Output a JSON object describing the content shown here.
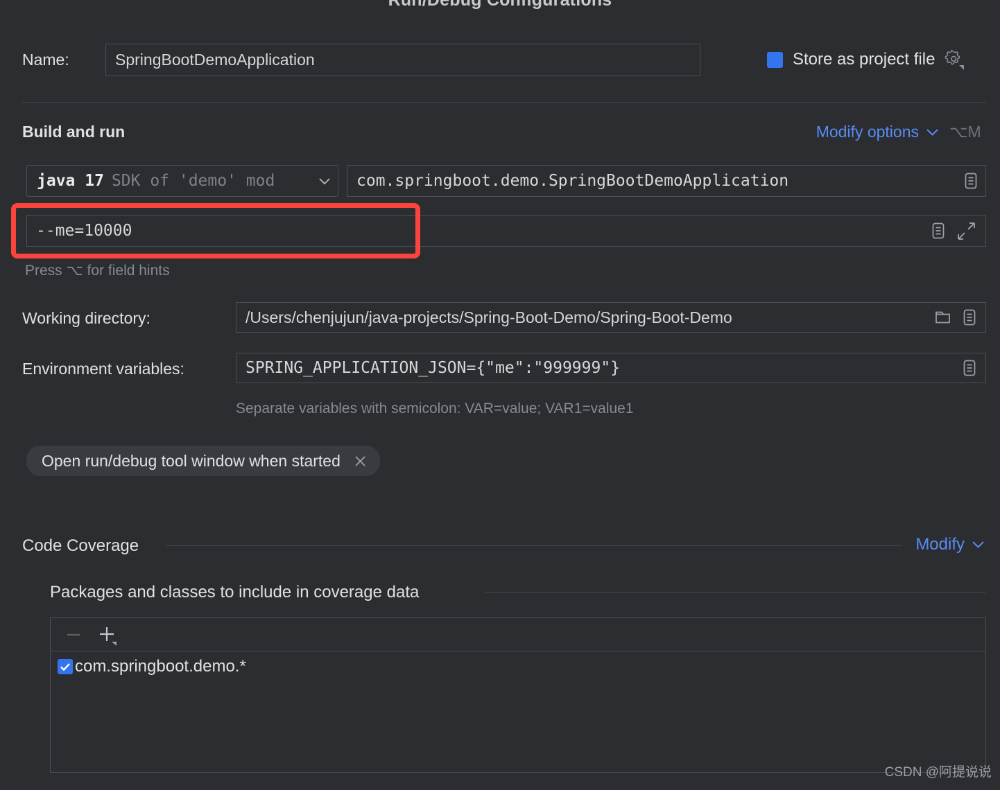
{
  "dialog": {
    "title": "Run/Debug Configurations"
  },
  "name_row": {
    "label": "Name:",
    "value": "SpringBootDemoApplication",
    "store_as_project_file_label": "Store as project file",
    "gear_icon": "gear-icon"
  },
  "build_and_run": {
    "section_title": "Build and run",
    "modify_options_label": "Modify options",
    "modify_options_shortcut": "⌥M",
    "sdk": {
      "name": "java 17",
      "description": "SDK of 'demo' mod"
    },
    "main_class": "com.springboot.demo.SpringBootDemoApplication",
    "program_arguments": "--me=10000",
    "field_hint": "Press ⌥ for field hints",
    "working_directory": {
      "label": "Working directory:",
      "value": "/Users/chenjujun/java-projects/Spring-Boot-Demo/Spring-Boot-Demo"
    },
    "environment_variables": {
      "label": "Environment variables:",
      "value": "SPRING_APPLICATION_JSON={\"me\":\"999999\"}",
      "hint": "Separate variables with semicolon: VAR=value; VAR1=value1"
    },
    "option_chip": {
      "label": "Open run/debug tool window when started",
      "close_icon": "close-icon"
    }
  },
  "code_coverage": {
    "section_title": "Code Coverage",
    "modify_label": "Modify",
    "packages_title": "Packages and classes to include in coverage data",
    "toolbar": {
      "remove_icon": "minus-icon",
      "add_icon": "plus-icon"
    },
    "items": [
      {
        "checked": true,
        "pattern": "com.springboot.demo.*"
      }
    ]
  },
  "annotation": {
    "color": "#f9453e",
    "target": "program-arguments-field"
  },
  "watermark": "CSDN @阿提说说",
  "colors": {
    "background": "#2b2d30",
    "accent_blue": "#3574f0",
    "link_blue": "#588cf3",
    "field_border": "#4b4f56",
    "text": "#dfe1e5",
    "muted_text": "#868a91",
    "annotation_red": "#f9453e"
  }
}
